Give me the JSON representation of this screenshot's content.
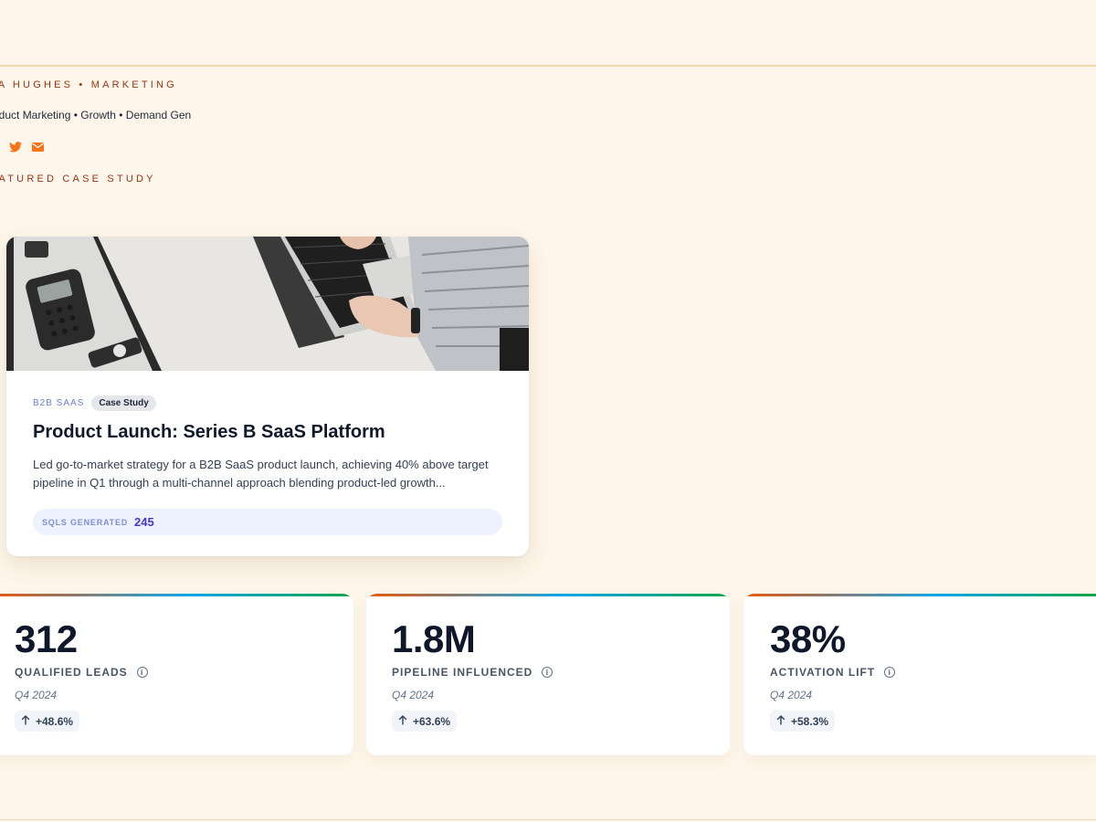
{
  "header": {
    "author_line": "VA HUGHES • MARKETING",
    "tagline": "oduct Marketing • Growth • Demand Gen",
    "socials": [
      {
        "icon": "twitter-icon",
        "color": "#f97316"
      },
      {
        "icon": "mail-icon",
        "color": "#f97316"
      }
    ]
  },
  "featured": {
    "section_label": "EATURED CASE STUDY",
    "card": {
      "category": "B2B SAAS",
      "badge": "Case Study",
      "title": "Product Launch: Series B SaaS Platform",
      "description": "Led go-to-market strategy for a B2B SaaS product launch, achieving 40% above target pipeline in Q1 through a multi-channel approach blending product-led growth...",
      "metric_label": "SQLS GENERATED",
      "metric_value": "245"
    }
  },
  "stats": [
    {
      "value": "312",
      "label": "QUALIFIED LEADS",
      "period": "Q4 2024",
      "change": "+48.6%"
    },
    {
      "value": "1.8M",
      "label": "PIPELINE INFLUENCED",
      "period": "Q4 2024",
      "change": "+63.6%"
    },
    {
      "value": "38%",
      "label": "ACTIVATION LIFT",
      "period": "Q4 2024",
      "change": "+58.3%"
    }
  ],
  "colors": {
    "background": "#fef6ea",
    "accent": "#9a3412",
    "brand_orange": "#f97316",
    "metric_value": "#4338ca"
  }
}
